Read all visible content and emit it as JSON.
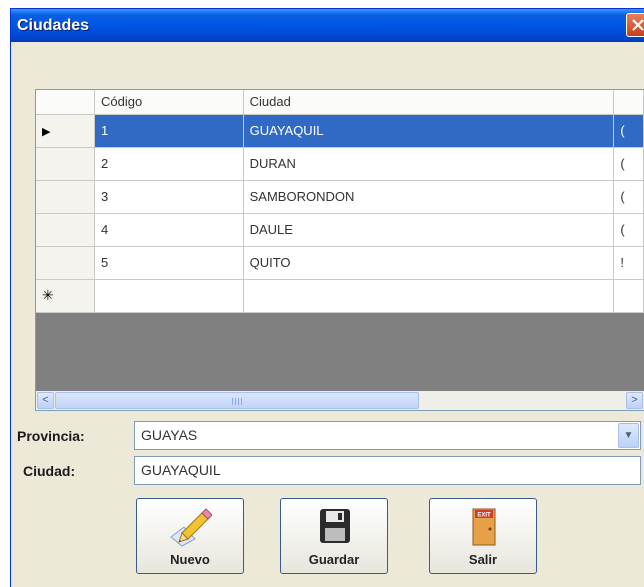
{
  "window": {
    "title": "Ciudades"
  },
  "grid": {
    "columns": [
      "Código",
      "Ciudad"
    ],
    "rows": [
      {
        "codigo": "1",
        "ciudad": "GUAYAQUIL",
        "extra": "("
      },
      {
        "codigo": "2",
        "ciudad": "DURAN",
        "extra": "("
      },
      {
        "codigo": "3",
        "ciudad": "SAMBORONDON",
        "extra": "("
      },
      {
        "codigo": "4",
        "ciudad": "DAULE",
        "extra": "("
      },
      {
        "codigo": "5",
        "ciudad": "QUITO",
        "extra": "!"
      }
    ],
    "selected_row_marker": "▶",
    "new_row_marker": "✳",
    "scroll_left": "<",
    "scroll_right": ">"
  },
  "form": {
    "provincia_label": "Provincia:",
    "provincia_value": "GUAYAS",
    "ciudad_label": "Ciudad:",
    "ciudad_value": "GUAYAQUIL"
  },
  "buttons": {
    "nuevo": "Nuevo",
    "guardar": "Guardar",
    "salir": "Salir",
    "exit_sign": "EXIT"
  },
  "icons": [
    "close-icon",
    "row-pointer-icon",
    "new-row-icon",
    "scroll-left-icon",
    "scroll-right-icon",
    "dropdown-arrow-icon",
    "pencil-icon",
    "floppy-disk-icon",
    "exit-door-icon"
  ]
}
